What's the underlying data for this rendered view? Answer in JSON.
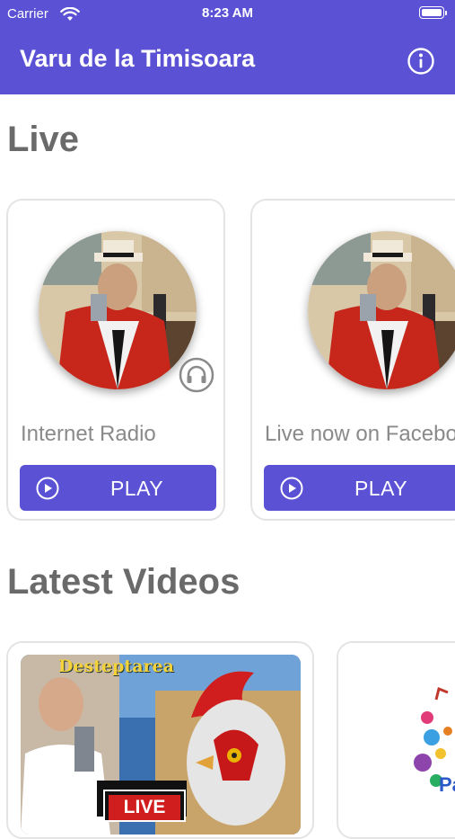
{
  "status": {
    "carrier": "Carrier",
    "time": "8:23 AM"
  },
  "nav": {
    "title": "Varu de la Timisoara",
    "info_icon": "info-circle-icon"
  },
  "sections": {
    "live": "Live",
    "videos": "Latest Videos"
  },
  "live_cards": [
    {
      "label": "Internet Radio",
      "button": "PLAY",
      "icon": "headphones-icon"
    },
    {
      "label": "Live now on Facebook",
      "button": "PLAY"
    }
  ],
  "videos": [
    {
      "thumb_title": "Desteptarea",
      "badge": "LIVE"
    },
    {
      "thumb_title": "Pa"
    }
  ],
  "colors": {
    "accent": "#5a51d4",
    "heading": "#6a6a6a",
    "label": "#8a8a8a"
  }
}
